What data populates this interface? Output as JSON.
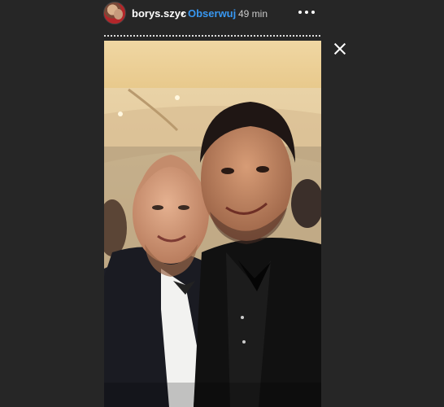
{
  "header": {
    "username": "borys.szyc",
    "separator": "•",
    "follow_label": "Obserwuj",
    "time_ago": "49 min"
  },
  "icons": {
    "avatar": "profile-avatar",
    "more": "more-options-icon",
    "close": "close-icon"
  },
  "colors": {
    "background": "#262626",
    "follow_accent": "#3897f0"
  }
}
